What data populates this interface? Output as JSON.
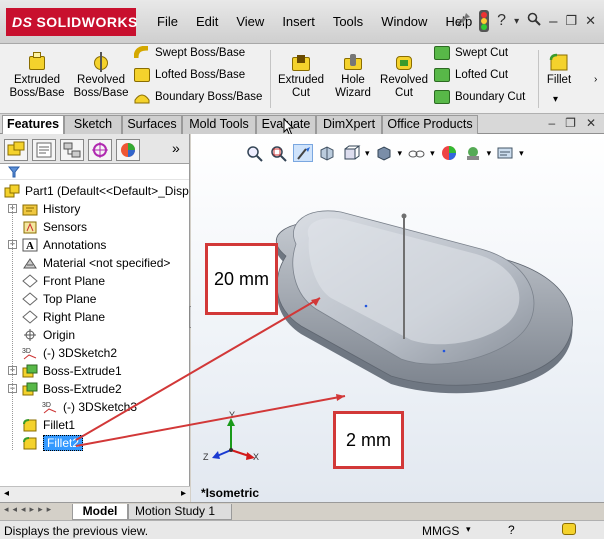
{
  "app": {
    "logo_text": "SOLIDWORKS",
    "logo_mark": "DS"
  },
  "menu": [
    "File",
    "Edit",
    "View",
    "Insert",
    "Tools",
    "Window",
    "Help"
  ],
  "title_icons": [
    "pushpin-icon",
    "traffic-light-icon",
    "help-icon",
    "search-icon",
    "minimize-icon",
    "restore-icon",
    "close-icon"
  ],
  "title_glyphs": {
    "help": "?",
    "minimize": "–",
    "restore": "❐",
    "close": "✕",
    "dropdown": "▾"
  },
  "commands": {
    "extruded_boss": "Extruded\nBoss/Base",
    "revolved_boss": "Revolved\nBoss/Base",
    "swept_boss": "Swept Boss/Base",
    "lofted_boss": "Lofted Boss/Base",
    "boundary_boss": "Boundary Boss/Base",
    "extruded_cut": "Extruded\nCut",
    "hole_wizard": "Hole\nWizard",
    "revolved_cut": "Revolved\nCut",
    "swept_cut": "Swept Cut",
    "lofted_cut": "Lofted Cut",
    "boundary_cut": "Boundary Cut",
    "fillet": "Fillet"
  },
  "tabs": [
    "Features",
    "Sketch",
    "Surfaces",
    "Mold Tools",
    "Evaluate",
    "DimXpert",
    "Office Products"
  ],
  "active_tab": "Features",
  "tree": {
    "root": "Part1  (Default<<Default>_Disp",
    "items": [
      {
        "label": "History",
        "icon": "history-folder-icon",
        "expandable": true
      },
      {
        "label": "Sensors",
        "icon": "sensors-icon",
        "expandable": false
      },
      {
        "label": "Annotations",
        "icon": "annotations-icon",
        "expandable": true
      },
      {
        "label": "Material <not specified>",
        "icon": "material-icon",
        "expandable": false
      },
      {
        "label": "Front Plane",
        "icon": "plane-icon",
        "expandable": false
      },
      {
        "label": "Top Plane",
        "icon": "plane-icon",
        "expandable": false
      },
      {
        "label": "Right Plane",
        "icon": "plane-icon",
        "expandable": false
      },
      {
        "label": "Origin",
        "icon": "origin-icon",
        "expandable": false
      },
      {
        "label": "(-) 3DSketch2",
        "icon": "3dsketch-icon",
        "expandable": false
      },
      {
        "label": "Boss-Extrude1",
        "icon": "extrude-icon",
        "expandable": true
      },
      {
        "label": "Boss-Extrude2",
        "icon": "extrude-icon",
        "expandable": true,
        "expanded": true
      },
      {
        "label": "(-) 3DSketch3",
        "icon": "3dsketch-icon",
        "expandable": false,
        "child": true
      },
      {
        "label": "Fillet1",
        "icon": "fillet-icon",
        "expandable": false
      },
      {
        "label": "Fillet2",
        "icon": "fillet-icon",
        "expandable": false,
        "selected": true
      }
    ]
  },
  "viewport": {
    "view_label": "*Isometric",
    "triad": {
      "x": "X",
      "y": "Y",
      "z": "Z"
    },
    "callouts": [
      {
        "text": "20 mm",
        "target": "top fillet"
      },
      {
        "text": "2 mm",
        "target": "base fillet"
      }
    ]
  },
  "bottom_tabs": [
    "Model",
    "Motion Study 1"
  ],
  "active_bottom_tab": "Model",
  "status": {
    "message": "Displays the previous view.",
    "units": "MMGS"
  },
  "colors": {
    "accent_red": "#d23838",
    "logo_red": "#c8102e",
    "selection_blue": "#3399ff",
    "part_gray": "#a8aeb6"
  }
}
